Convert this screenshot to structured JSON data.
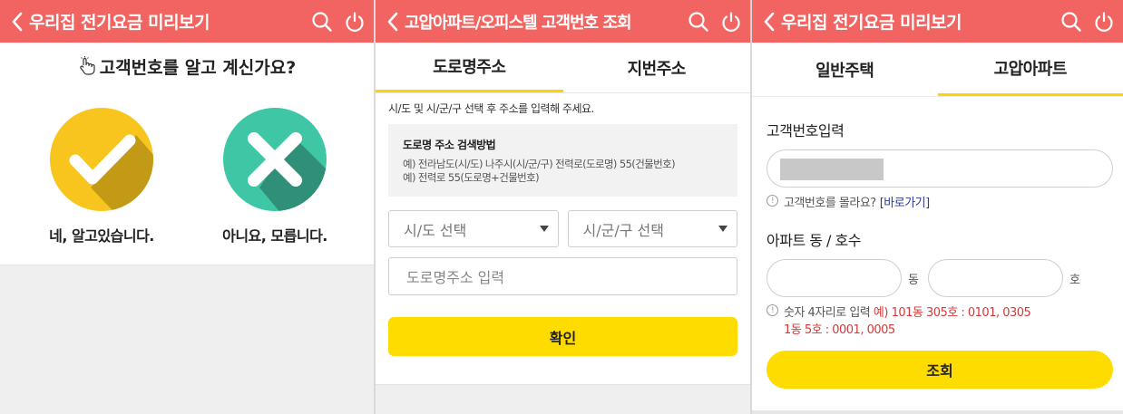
{
  "colors": {
    "header": "#f26462",
    "accent_yellow": "#ffdc00",
    "check_yellow": "#f7c51e",
    "cross_teal": "#3fc7a5",
    "link": "#2f3a8f",
    "error_red": "#d23a3a"
  },
  "screen1": {
    "header": {
      "title": "우리집 전기요금 미리보기",
      "back_icon": "chevron-left-icon",
      "search_icon": "search-icon",
      "power_icon": "power-icon"
    },
    "question": "고객번호를 알고 계신가요?",
    "yes_label": "네, 알고있습니다.",
    "no_label": "아니요, 모릅니다."
  },
  "screen2": {
    "header": {
      "title": "고압아파트/오피스텔 고객번호 조회"
    },
    "tabs": [
      {
        "label": "도로명주소",
        "active": true
      },
      {
        "label": "지번주소",
        "active": false
      }
    ],
    "hint": "시/도 및 시/군/구 선택 후 주소를 입력해 주세요.",
    "guide": {
      "title": "도로명 주소 검색방법",
      "line1": "예) 전라남도(시/도) 나주시(시/군/구) 전력로(도로명) 55(건물번호)",
      "line2": "예) 전력로 55(도로명+건물번호)"
    },
    "select_sido": "시/도 선택",
    "select_sigungu": "시/군/구 선택",
    "road_placeholder": "도로명주소 입력",
    "confirm_label": "확인"
  },
  "screen3": {
    "header": {
      "title": "우리집 전기요금 미리보기"
    },
    "tabs": [
      {
        "label": "일반주택",
        "active": false
      },
      {
        "label": "고압아파트",
        "active": true
      }
    ],
    "customer_label": "고객번호입력",
    "notice1_text": "고객번호를 몰라요?",
    "notice1_link": "[바로가기]",
    "apt_label": "아파트 동 / 호수",
    "dong_unit": "동",
    "ho_unit": "호",
    "notice2_text": "숫자 4자리로 입력",
    "notice2_example1": "예) 101동 305호 : 0101, 0305",
    "notice2_example2": "1동 5호 : 0001, 0005",
    "lookup_label": "조회"
  }
}
